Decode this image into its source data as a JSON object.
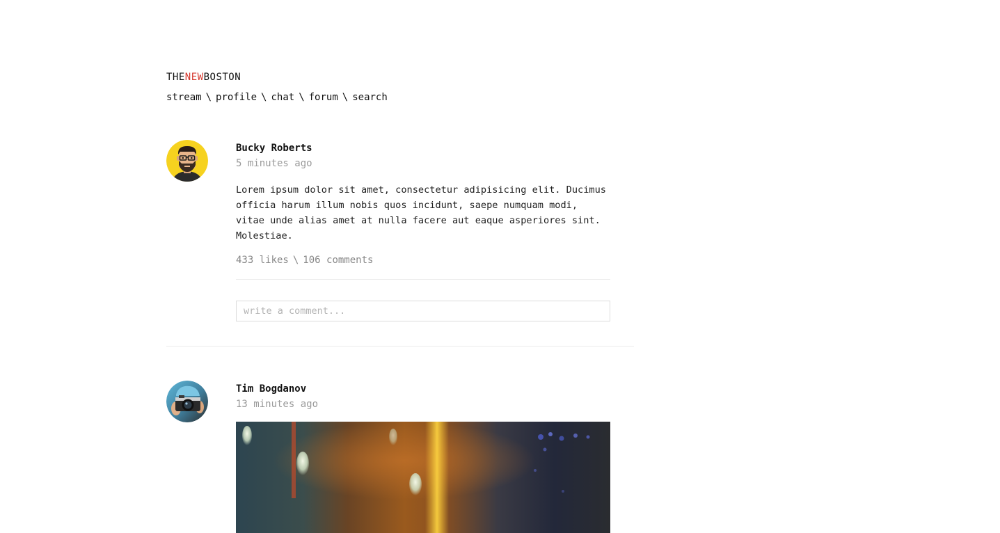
{
  "brand": {
    "part1": "THE",
    "part2": "NEW",
    "part3": "BOSTON",
    "accent_color": "#d63a2f"
  },
  "nav": {
    "items": [
      {
        "label": "stream"
      },
      {
        "label": "profile"
      },
      {
        "label": "chat"
      },
      {
        "label": "forum"
      },
      {
        "label": "search"
      }
    ],
    "separator": "\\"
  },
  "posts": [
    {
      "author": "Bucky Roberts",
      "time": "5 minutes ago",
      "avatar_icon": "avatar-bearded-glasses",
      "text": "Lorem ipsum dolor sit amet, consectetur adipisicing elit. Ducimus officia harum illum nobis quos incidunt, saepe numquam modi, vitae unde alias amet at nulla facere aut eaque asperiores sint. Molestiae.",
      "likes": "433 likes",
      "comments": "106 comments",
      "stats_separator": "\\",
      "comment_placeholder": "write a comment..."
    },
    {
      "author": "Tim Bogdanov",
      "time": "13 minutes ago",
      "avatar_icon": "avatar-camera-photographer",
      "image_icon": "bokeh-lightbulbs-photo"
    }
  ]
}
